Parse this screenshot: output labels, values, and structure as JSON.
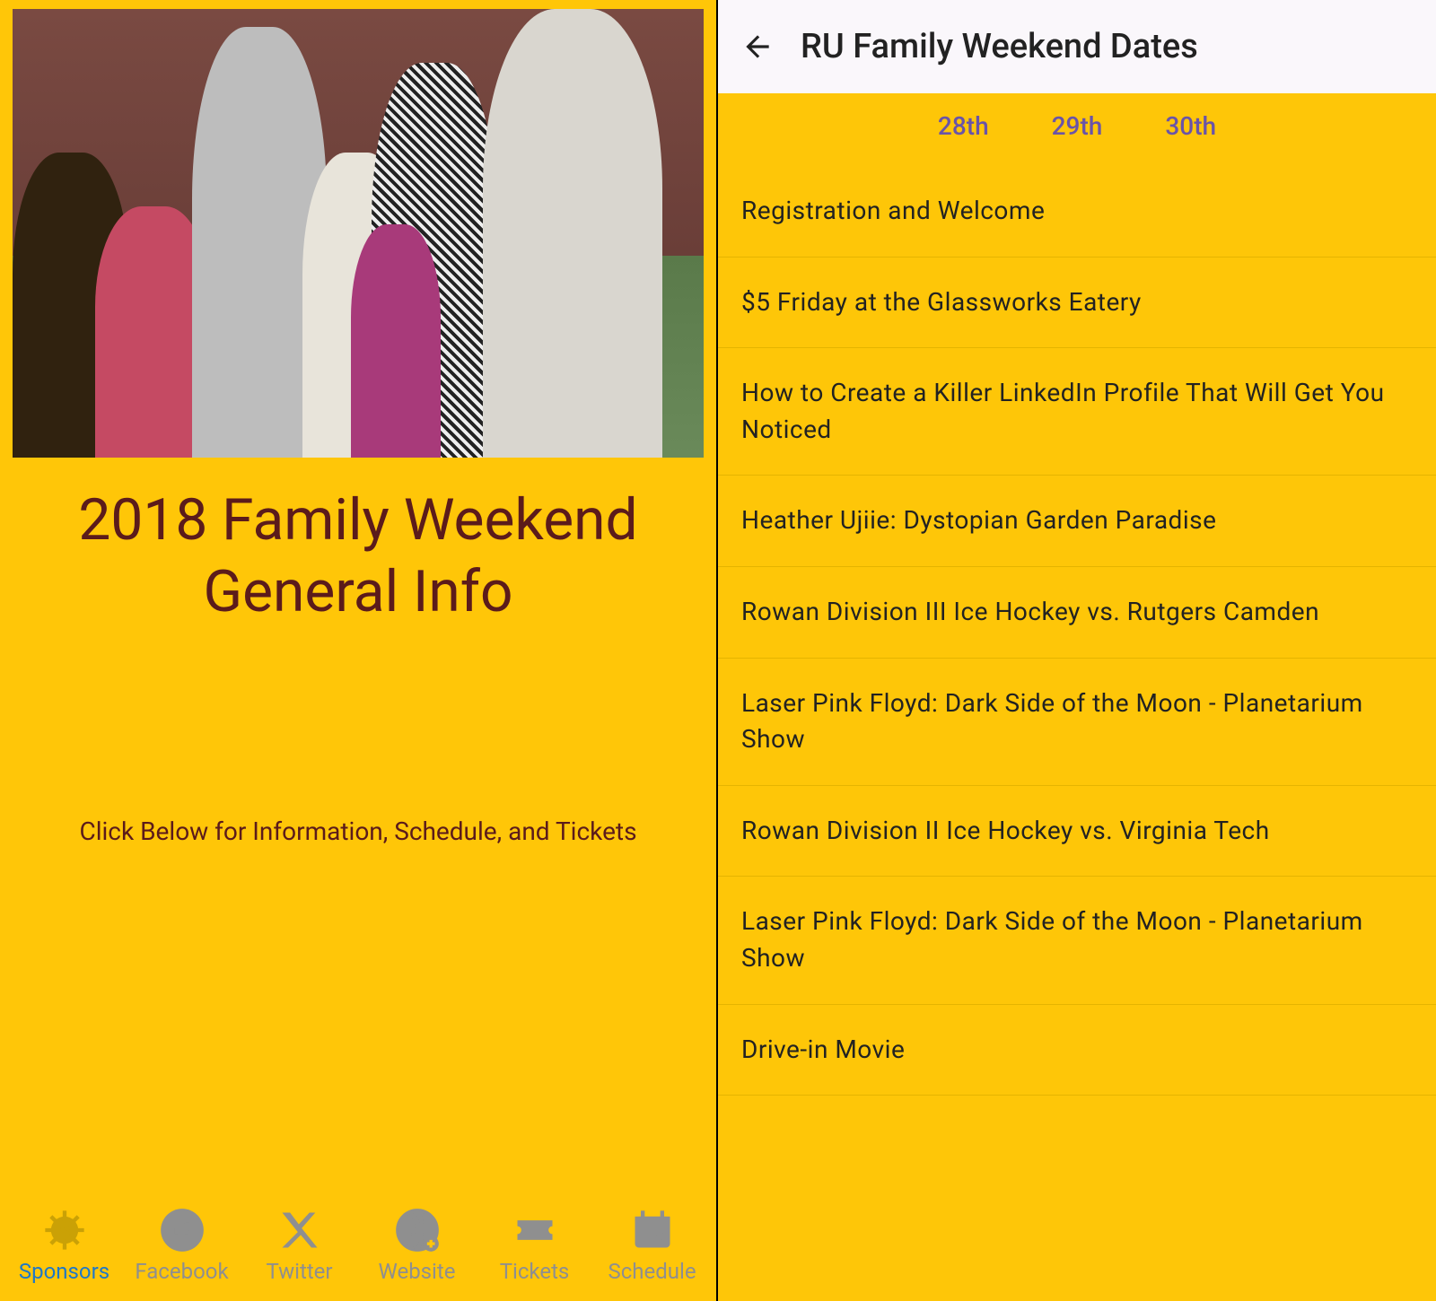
{
  "left": {
    "title": "2018 Family Weekend General Info",
    "subtext": "Click Below for Information, Schedule, and Tickets",
    "nav": {
      "sponsors": "Sponsors",
      "facebook": "Facebook",
      "twitter": "Twitter",
      "website": "Website",
      "tickets": "Tickets",
      "schedule": "Schedule"
    }
  },
  "right": {
    "appbar_title": "RU Family Weekend Dates",
    "tabs": {
      "t1": "28th",
      "t2": "29th",
      "t3": "30th"
    },
    "events": [
      "Registration and Welcome",
      "$5 Friday at the Glassworks Eatery",
      "How to Create a Killer LinkedIn Profile That Will Get You Noticed",
      "Heather Ujiie: Dystopian Garden Paradise",
      "Rowan Division III Ice Hockey vs. Rutgers Camden",
      "Laser Pink Floyd: Dark Side of the Moon - Planetarium Show",
      "Rowan Division II Ice Hockey vs. Virginia Tech",
      "Laser Pink Floyd: Dark Side of the Moon - Planetarium Show",
      "Drive-in Movie"
    ]
  },
  "colors": {
    "brand_yellow": "#ffc608",
    "brand_maroon": "#5b1b1b",
    "tab_purple": "#6a54a8",
    "nav_active_blue": "#1e78c8",
    "nav_inactive_grey": "#8f8f8f"
  }
}
